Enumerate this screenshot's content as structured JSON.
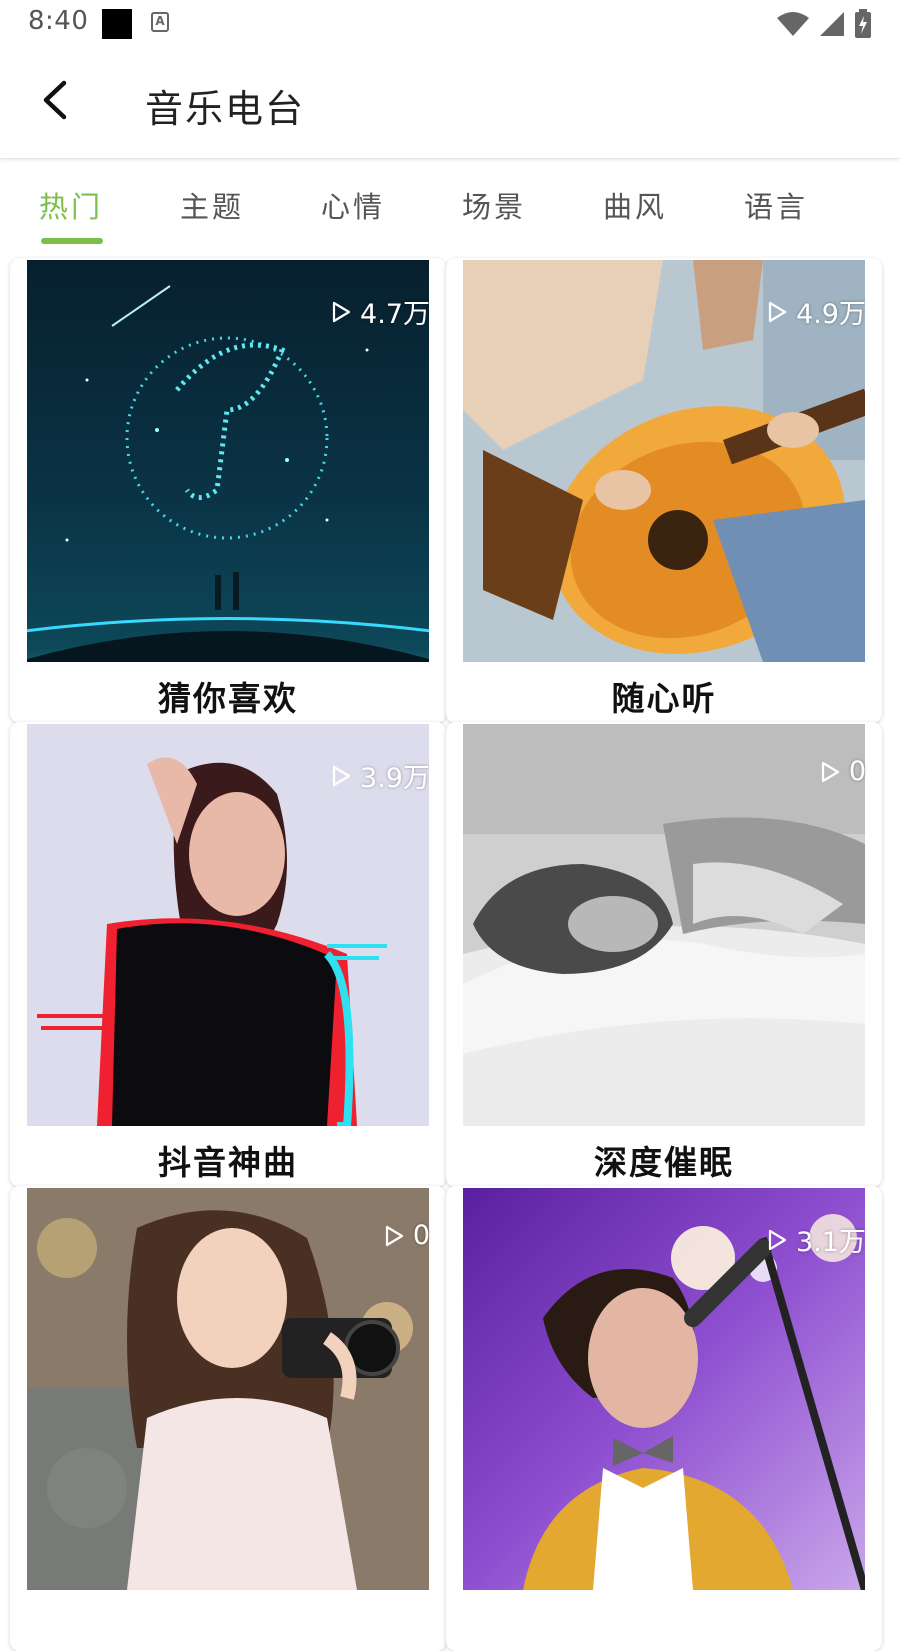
{
  "status": {
    "time": "8:40"
  },
  "header": {
    "title": "音乐电台"
  },
  "tabs": [
    {
      "label": "热门",
      "active": true
    },
    {
      "label": "主题",
      "active": false
    },
    {
      "label": "心情",
      "active": false
    },
    {
      "label": "场景",
      "active": false
    },
    {
      "label": "曲风",
      "active": false
    },
    {
      "label": "语言",
      "active": false
    }
  ],
  "colors": {
    "accent": "#7cc04b"
  },
  "stations": [
    {
      "title": "猜你喜欢",
      "plays": "4.7万",
      "cover": "starry-music-note"
    },
    {
      "title": "随心听",
      "plays": "4.9万",
      "cover": "guitar-player"
    },
    {
      "title": "抖音神曲",
      "plays": "3.9万",
      "cover": "glitch-portrait"
    },
    {
      "title": "深度催眠",
      "plays": "0",
      "cover": "sleeping-person"
    },
    {
      "title": "",
      "plays": "0",
      "cover": "woman-with-camera"
    },
    {
      "title": "",
      "plays": "3.1万",
      "cover": "singer-with-microphone"
    }
  ]
}
